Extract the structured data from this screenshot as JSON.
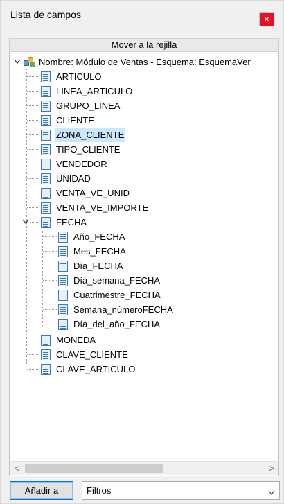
{
  "window": {
    "title": "Lista de campos",
    "close_glyph": "×"
  },
  "move_bar": {
    "label": "Mover a la rejilla"
  },
  "tree": {
    "root": {
      "label": "Nombre: Módulo de Ventas  -  Esquema: EsquemaVer",
      "icon": "cube-icon",
      "expanded": true
    },
    "fields": [
      {
        "label": "ARTICULO"
      },
      {
        "label": "LINEA_ARTICULO"
      },
      {
        "label": "GRUPO_LINEA"
      },
      {
        "label": "CLIENTE"
      },
      {
        "label": "ZONA_CLIENTE",
        "selected": true
      },
      {
        "label": "TIPO_CLIENTE"
      },
      {
        "label": "VENDEDOR"
      },
      {
        "label": "UNIDAD"
      },
      {
        "label": "VENTA_VE_UNID"
      },
      {
        "label": "VENTA_VE_IMPORTE"
      }
    ],
    "fecha": {
      "label": "FECHA",
      "expanded": true,
      "children": [
        {
          "label": "Año_FECHA"
        },
        {
          "label": "Mes_FECHA"
        },
        {
          "label": "Día_FECHA"
        },
        {
          "label": "Día_semana_FECHA"
        },
        {
          "label": "Cuatrimestre_FECHA"
        },
        {
          "label": "Semana_númeroFECHA"
        },
        {
          "label": "Día_del_año_FECHA"
        }
      ]
    },
    "fields_after": [
      {
        "label": "MONEDA"
      },
      {
        "label": "CLAVE_CLIENTE"
      },
      {
        "label": "CLAVE_ARTICULO"
      }
    ]
  },
  "scrollbar": {
    "left_glyph": "<",
    "right_glyph": ">"
  },
  "footer": {
    "add_button": "Añadir a",
    "dropdown_value": "Filtros"
  },
  "colors": {
    "selection": "#cce8ff",
    "close_button": "#e81123",
    "focus_border": "#0078d7"
  }
}
